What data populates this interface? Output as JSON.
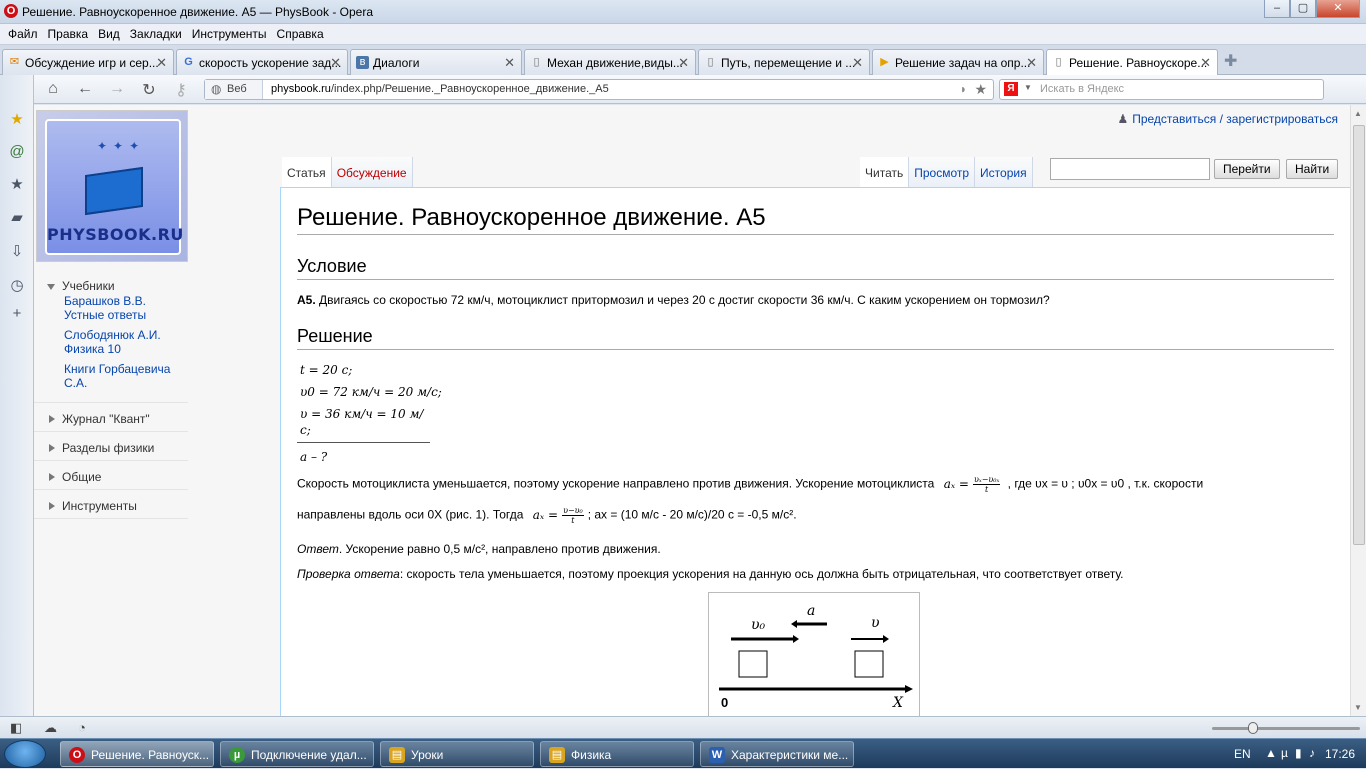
{
  "window": {
    "title": "Решение. Равноускоренное движение. А5 — PhysBook - Opera",
    "buttons": [
      "–",
      "▢",
      "✕"
    ]
  },
  "menu": [
    "Файл",
    "Правка",
    "Вид",
    "Закладки",
    "Инструменты",
    "Справка"
  ],
  "tabs": [
    {
      "label": "Обсуждение игр и сер...",
      "icon": "forum-icon"
    },
    {
      "label": "скорость ускорение зад...",
      "icon": "google-icon"
    },
    {
      "label": "Диалоги",
      "icon": "vk-icon"
    },
    {
      "label": "Механ движение,виды...",
      "icon": "page-icon"
    },
    {
      "label": "Путь, перемещение и ...",
      "icon": "page-icon"
    },
    {
      "label": "Решение задач на опр...",
      "icon": "video-icon"
    },
    {
      "label": "Решение. Равноускоре...",
      "icon": "page-icon"
    }
  ],
  "address": {
    "mode": "Веб",
    "host": "physbook.ru",
    "path": "/index.php/Решение._Равноускоренное_движение._А5"
  },
  "search": {
    "placeholder": "Искать в Яндекс",
    "engine": "Я"
  },
  "sidebar": {
    "logo_text": "PHYSBOOK.RU",
    "textbooks_label": "Учебники",
    "textbooks": [
      "Барашков В.В. Устные ответы",
      "Слободянюк А.И. Физика 10",
      "Книги Горбацевича С.А."
    ],
    "sections": [
      "Журнал \"Квант\"",
      "Разделы физики",
      "Общие",
      "Инструменты"
    ]
  },
  "personal": "Представиться / зарегистрироваться",
  "views": {
    "article": "Статья",
    "discussion": "Обсуждение",
    "read": "Читать",
    "view_source": "Просмотр",
    "history": "История",
    "go": "Перейти",
    "find": "Найти"
  },
  "article": {
    "title": "Решение. Равноускоренное движение. А5",
    "condition_heading": "Условие",
    "task_label": "А5.",
    "task_text": " Двигаясь со скоростью 72 км/ч, мотоциклист притормозил и через 20 с достиг скорости 36 км/ч. С каким ускорением он тормозил?",
    "solution_heading": "Решение",
    "given": [
      "t = 20 с;",
      "υ0 = 72 км/ч = 20 м/с;",
      "υ = 36 км/ч = 10 м/с;",
      "a – ?"
    ],
    "para1a": "Скорость мотоциклиста уменьшается, поэтому ускорение направлено против движения. Ускорение мотоциклиста",
    "para1b": ", где υx = υ ; υ0x = υ0 , т.к. скорости",
    "para2a": "направлены вдоль оси 0X (рис. 1). Тогда",
    "para2b": "; ax = (10 м/с - 20 м/с)/20 с = -0,5 м/с².",
    "answer_label": "Ответ",
    "answer_text": ". Ускорение равно 0,5 м/с², направлено против движения.",
    "check_label": "Проверка ответа",
    "check_text": ": скорость тела уменьшается, поэтому проекция ускорения на данную ось должна быть отрицательная, что соответствует ответу.",
    "formula1": {
      "lhs": "aₓ =",
      "num": "υₓ−υ₀ₓ",
      "den": "t"
    },
    "formula2": {
      "lhs": "aₓ =",
      "num": "υ−υ₀",
      "den": "t"
    },
    "figure": {
      "v0": "υ₀",
      "a": "a",
      "v": "υ",
      "origin": "0",
      "axis": "X"
    }
  },
  "taskbar": [
    {
      "label": "Решение. Равноуск...",
      "icon": "O",
      "color": "#cc0f16"
    },
    {
      "label": "Подключение удал...",
      "icon": "µ",
      "color": "#3a9a3a"
    },
    {
      "label": "Уроки",
      "icon": "▤",
      "color": "#d9a520"
    },
    {
      "label": "Физика",
      "icon": "▤",
      "color": "#d9a520"
    },
    {
      "label": "Характеристики ме...",
      "icon": "W",
      "color": "#2b5fb0"
    }
  ],
  "tray": {
    "lang": "EN",
    "time": "17:26"
  }
}
